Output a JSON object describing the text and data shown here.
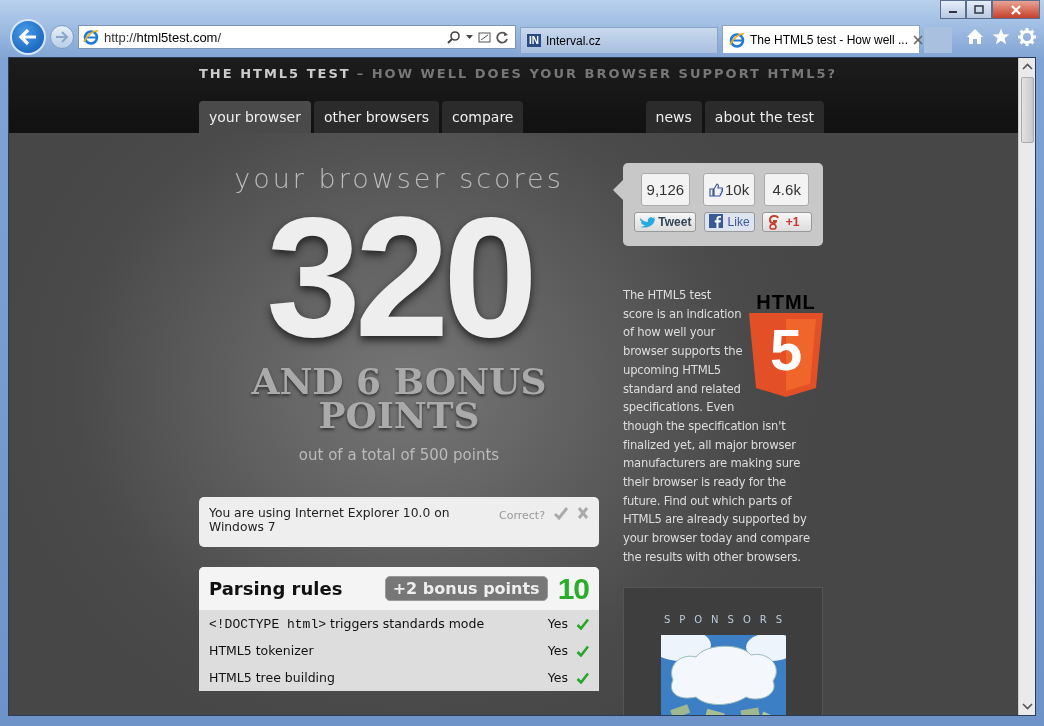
{
  "browser": {
    "address": "http://**html5test.com**/",
    "tabs": [
      {
        "badge": "IN",
        "title": "Interval.cz",
        "selected": false
      },
      {
        "title": "The HTML5 test - How well ...",
        "selected": true
      }
    ]
  },
  "site": {
    "title": "THE HTML5 TEST",
    "subtitle": "– HOW WELL DOES YOUR BROWSER SUPPORT HTML5?",
    "nav_left": [
      {
        "label": "your browser",
        "selected": true
      },
      {
        "label": "other browsers",
        "selected": false
      },
      {
        "label": "compare",
        "selected": false
      }
    ],
    "nav_right": [
      {
        "label": "news",
        "selected": false
      },
      {
        "label": "about the test",
        "selected": false
      }
    ]
  },
  "score": {
    "heading": "your browser scores",
    "points": "320",
    "bonus": "AND 6 BONUS POINTS",
    "total": "out of a total of 500 points"
  },
  "detection": {
    "text": "You are using Internet Explorer 10.0 on Windows 7",
    "prompt": "Correct?"
  },
  "section": {
    "title": "Parsing rules",
    "bonus": "+2 bonus points",
    "score": "10",
    "tests": [
      {
        "code": "<!DOCTYPE html>",
        "name": "triggers standards mode",
        "result": "Yes",
        "passed": true
      },
      {
        "name": "HTML5 tokenizer",
        "result": "Yes",
        "passed": true
      },
      {
        "name": "HTML5 tree building",
        "result": "Yes",
        "passed": true
      }
    ]
  },
  "social": [
    {
      "kind": "twitter",
      "count": "9,126",
      "label": "Tweet"
    },
    {
      "kind": "facebook",
      "count": "10k",
      "label": "Like"
    },
    {
      "kind": "google",
      "count": "4.6k",
      "label": "+1"
    }
  ],
  "about": {
    "logo": "HTML",
    "logo_digit": "5",
    "text": [
      "The HTML5 test score is an indication of how well your browser supports the upcoming HTML5 standard and related specifications. Even",
      "though the specification isn't finalized yet, all major browser manufacturers are making sure their browser is ready for the future. Find out which parts of HTML5 are already supported by your browser today and compare the results with other browsers."
    ]
  },
  "sponsors": {
    "heading": "SPONSORS"
  }
}
